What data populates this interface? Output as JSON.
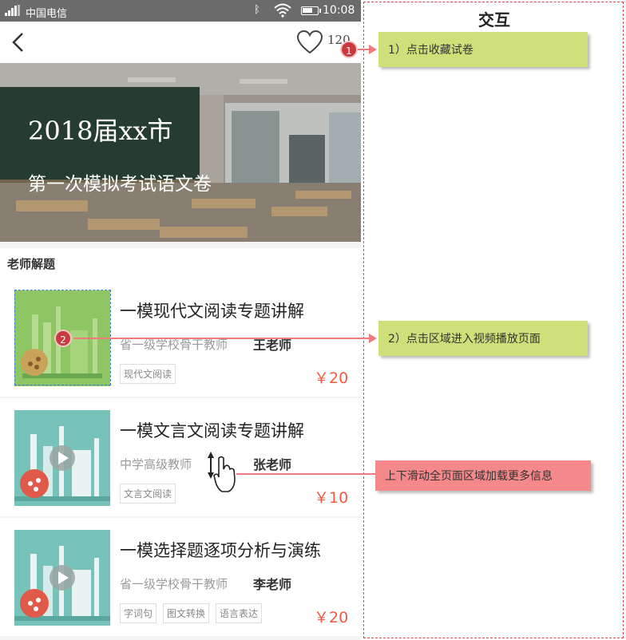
{
  "statusbar": {
    "carrier": "中国电信",
    "time": "10:08"
  },
  "navbar": {
    "favorite_count": "120"
  },
  "banner": {
    "title": "2018届xx市",
    "subtitle": "第一次模拟考试语文卷"
  },
  "section": {
    "title": "老师解题"
  },
  "courses": [
    {
      "title": "一模现代文阅读专题讲解",
      "teacher_desc": "省一级学校骨干教师",
      "teacher_name": "王老师",
      "tags": [
        "现代文阅读"
      ],
      "price": "￥20"
    },
    {
      "title": "一模文言文阅读专题讲解",
      "teacher_desc": "中学高级教师",
      "teacher_name": "张老师",
      "tags": [
        "文言文阅读"
      ],
      "price": "￥10"
    },
    {
      "title": "一模选择题逐项分析与演练",
      "teacher_desc": "省一级学校骨干教师",
      "teacher_name": "李老师",
      "tags": [
        "字词句",
        "图文转换",
        "语言表达"
      ],
      "price": "￥20"
    }
  ],
  "annotations": {
    "title": "交互",
    "notes": [
      {
        "badge": "1",
        "text": "1）点击收藏试卷"
      },
      {
        "badge": "2",
        "text": "2）点击区域进入视频播放页面"
      },
      {
        "text": "上下滑动全页面区域加载更多信息"
      }
    ]
  },
  "colors": {
    "price": "#ee5a43",
    "note_green": "#cfe07a",
    "note_red": "#f5888a",
    "badge": "#c83a3d",
    "annotation_border": "#d9464e"
  }
}
